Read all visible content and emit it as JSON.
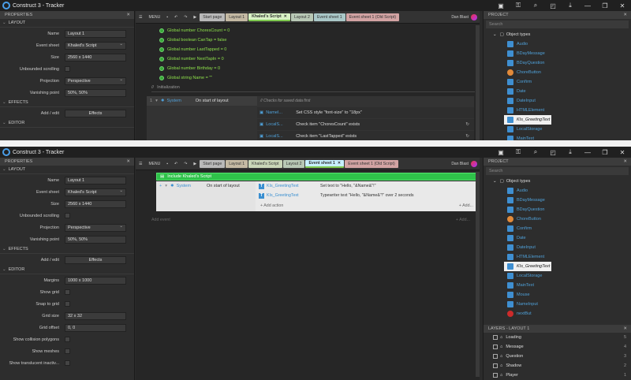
{
  "title": "Construct 3 - Tracker",
  "top": {
    "menu": "MENU",
    "tabs": [
      {
        "label": "Start page",
        "bg": "#b9b9b9"
      },
      {
        "label": "Layout 1",
        "bg": "#c4b9a3"
      },
      {
        "label": "Khaled's Script",
        "bg": "#d9f2c5",
        "active": true
      },
      {
        "label": "Layout 2",
        "bg": "#b8c8b5"
      },
      {
        "label": "Event sheet 1",
        "bg": "#a9c7c7"
      },
      {
        "label": "Event sheet 1 (Old Script)",
        "bg": "#d2a3a3"
      }
    ],
    "user": "Dan Blast",
    "props": {
      "header": "PROPERTIES",
      "layout": "LAYOUT",
      "name_lbl": "Name",
      "name": "Layout 1",
      "es_lbl": "Event sheet",
      "es": "Khaled's Script",
      "size_lbl": "Size",
      "size": "2560 x 1440",
      "unb": "Unbounded scrolling",
      "proj_lbl": "Projection",
      "proj": "Perspective",
      "vp_lbl": "Vanishing point",
      "vp": "50%, 50%",
      "effects": "EFFECTS",
      "addedit": "Add / edit",
      "effects_btn": "Effects",
      "editor": "EDITOR"
    },
    "globals": [
      "Global number ChoresCount = 0",
      "Global boolean CanTap = false",
      "Global number LastTapped = 0",
      "Global number NextTapIn = 0",
      "Global number Birthday = 0",
      "Global string Name = \"\""
    ],
    "group": "Initialization",
    "system": "System",
    "cond": "On start of layout",
    "comment": "Checks for saved data first",
    "actions": [
      {
        "obj": "NameI...",
        "text": "Set CSS style \"font-size\" to \"18px\""
      },
      {
        "obj": "LocalS...",
        "text": "Check item \"ChoresCount\" exists"
      },
      {
        "obj": "LocalS...",
        "text": "Check item \"LastTapped\" exists"
      }
    ]
  },
  "bottom": {
    "menu": "MENU",
    "tabs": [
      {
        "label": "Start page",
        "bg": "#b9b9b9"
      },
      {
        "label": "Layout 1",
        "bg": "#c4b9a3"
      },
      {
        "label": "Khaled's Script",
        "bg": "#c9d6b8"
      },
      {
        "label": "Layout 2",
        "bg": "#b8c8b5"
      },
      {
        "label": "Event sheet 1",
        "bg": "#c7f0ff",
        "active": true
      },
      {
        "label": "Event sheet 1 (Old Script)",
        "bg": "#d2a3a3"
      }
    ],
    "user": "Dan Blast",
    "include": "Include Khaled's Script",
    "system": "System",
    "cond": "On start of layout",
    "actions": [
      {
        "obj": "KIs_GreetingText",
        "text": "Set text to \"Hello, \"&Name&\"!\""
      },
      {
        "obj": "KIs_GreetingText",
        "text": "Typewriter text \"Hello, \"&Name&\"!\" over 2 seconds"
      }
    ],
    "add_action": "+ Add action",
    "add_more": "+ Add...",
    "add_event": "Add event",
    "props": {
      "header": "PROPERTIES",
      "layout": "LAYOUT",
      "name_lbl": "Name",
      "name": "Layout 1",
      "es_lbl": "Event sheet",
      "es": "Khaled's Script",
      "size_lbl": "Size",
      "size": "2560 x 1440",
      "unb": "Unbounded scrolling",
      "proj_lbl": "Projection",
      "proj": "Perspective",
      "vp_lbl": "Vanishing point",
      "vp": "50%, 50%",
      "effects": "EFFECTS",
      "addedit": "Add / edit",
      "effects_btn": "Effects",
      "editor": "EDITOR",
      "margins_lbl": "Margins",
      "margins": "1000 x 1000",
      "showgrid": "Show grid",
      "snap": "Snap to grid",
      "gridsize_lbl": "Grid size",
      "gridsize": "32 x 32",
      "gridoff_lbl": "Grid offset",
      "gridoff": "0, 0",
      "collision": "Show collision polygons",
      "meshes": "Show meshes",
      "translucent": "Show translucent inactiv..."
    }
  },
  "project": {
    "header": "PROJECT",
    "search": "Search",
    "object_types": "Object types",
    "items": [
      {
        "name": "Audio",
        "color": "#3f8fd1"
      },
      {
        "name": "BDayMessage",
        "color": "#3f8fd1"
      },
      {
        "name": "BDayQuestion",
        "color": "#3f8fd1"
      },
      {
        "name": "ChoreButton",
        "color": "#e28a3a"
      },
      {
        "name": "Confirm",
        "color": "#3f8fd1"
      },
      {
        "name": "Date",
        "color": "#3f8fd1"
      },
      {
        "name": "DateInput",
        "color": "#3f8fd1"
      },
      {
        "name": "HTMLElement",
        "color": "#3f8fd1"
      },
      {
        "name": "KIs_GreetingText",
        "color": "#3f8fd1",
        "selected": true
      },
      {
        "name": "LocalStorage",
        "color": "#3f8fd1"
      },
      {
        "name": "MainText",
        "color": "#3f8fd1"
      },
      {
        "name": "Mouse",
        "color": "#3f8fd1"
      },
      {
        "name": "NameInput",
        "color": "#3f8fd1"
      },
      {
        "name": "nextBut",
        "color": "#cc2b2b"
      }
    ]
  },
  "layers": {
    "header": "LAYERS - LAYOUT 1",
    "items": [
      {
        "name": "Loading",
        "n": "5"
      },
      {
        "name": "Message",
        "n": "4"
      },
      {
        "name": "Question",
        "n": "3"
      },
      {
        "name": "Shadow",
        "n": "2"
      },
      {
        "name": "Player",
        "n": "1"
      }
    ]
  }
}
